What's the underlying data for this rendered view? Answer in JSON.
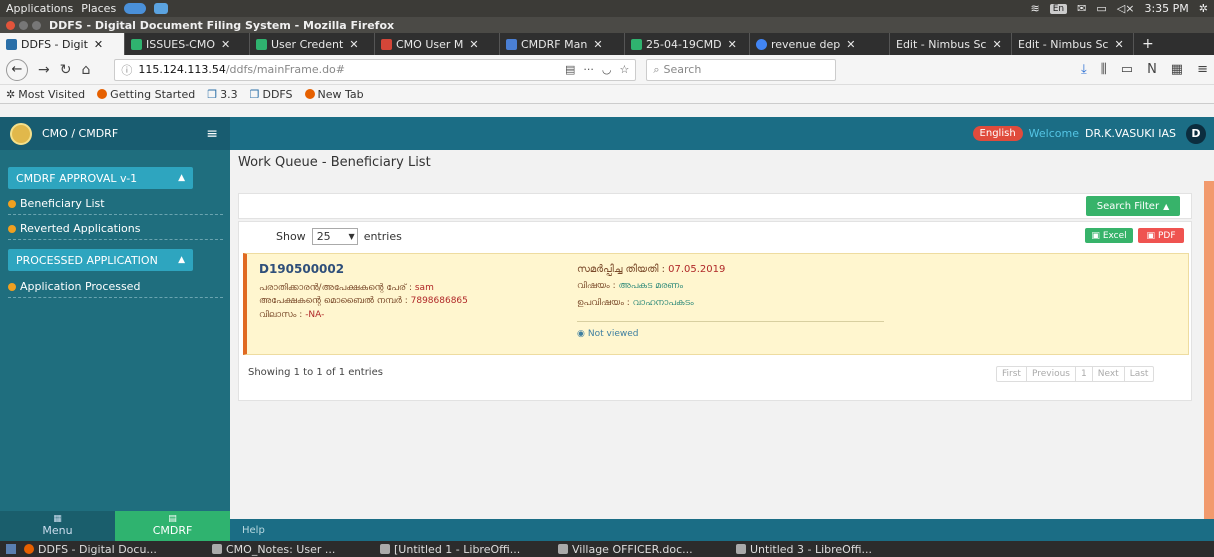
{
  "os": {
    "menus": [
      "Applications",
      "Places"
    ],
    "lang": "En",
    "time": "3:35 PM"
  },
  "window": {
    "title": "DDFS - Digital Document Filing System - Mozilla Firefox"
  },
  "tabs": [
    {
      "label": "DDFS - Digit",
      "active": true,
      "icon_color": "#2a6fa8"
    },
    {
      "label": "ISSUES-CMO",
      "active": false,
      "icon_color": "#2fb36f"
    },
    {
      "label": "User Credent",
      "active": false,
      "icon_color": "#2fb36f"
    },
    {
      "label": "CMO User M",
      "active": false,
      "icon_color": "#d44638"
    },
    {
      "label": "CMDRF Man",
      "active": false,
      "icon_color": "#4a7fd4"
    },
    {
      "label": "25-04-19CMD",
      "active": false,
      "icon_color": "#2fb36f"
    },
    {
      "label": "revenue dep",
      "active": false,
      "icon_color": "#4285f4"
    },
    {
      "label": "Edit - Nimbus Sc",
      "active": false,
      "icon_color": "#888888"
    },
    {
      "label": "Edit - Nimbus Sc",
      "active": false,
      "icon_color": "#888888"
    }
  ],
  "nav": {
    "url_host": "115.124.113.54",
    "url_path": "/ddfs/mainFrame.do#",
    "search_placeholder": "Search"
  },
  "bookmarks": [
    "Most Visited",
    "Getting Started",
    "3.3",
    "DDFS",
    "New Tab"
  ],
  "app": {
    "brand": "CMO / CMDRF",
    "language_button": "English",
    "welcome": "Welcome",
    "user_name": "DR.K.VASUKI IAS",
    "avatar_letter": "D"
  },
  "sidebar": {
    "section1": "CMDRF APPROVAL v-1",
    "items1": [
      "Beneficiary List",
      "Reverted Applications"
    ],
    "section2": "PROCESSED APPLICATION",
    "items2": [
      "Application Processed"
    ],
    "footer_menu": "Menu",
    "footer_cmdrf": "CMDRF",
    "help": "Help"
  },
  "main": {
    "title": "Work Queue - Beneficiary List",
    "filter_button": "Search Filter",
    "show_label": "Show",
    "entries_value": "25",
    "entries_label": "entries",
    "excel_button": "Excel",
    "pdf_button": "PDF",
    "showing": "Showing 1 to 1 of 1 entries",
    "pagination": [
      "First",
      "Previous",
      "1",
      "Next",
      "Last"
    ]
  },
  "record": {
    "id": "D190500002",
    "applicant_label": "പരാതിക്കാരൻ/അപേക്ഷകന്റെ പേര് :",
    "applicant_value": "sam",
    "mobile_label": "അപേക്ഷകന്റെ മൊബൈൽ നമ്പർ :",
    "mobile_value": "7898686865",
    "address_label": "വിലാസം :",
    "address_value": "-NA-",
    "date_label": "സമർപ്പിച്ച തിയതി :",
    "date_value": "07.05.2019",
    "subject_label": "വിഷയം :",
    "subject_value": "അപകട മരണം",
    "subsubject_label": "ഉപവിഷയം :",
    "subsubject_value": "വാഹനാപകടം",
    "status": "Not viewed"
  },
  "taskbar": [
    "DDFS - Digital Docu...",
    "CMO_Notes: User ...",
    "[Untitled 1 - LibreOffi...",
    "Village OFFICER.doc...",
    "Untitled 3 - LibreOffi..."
  ]
}
